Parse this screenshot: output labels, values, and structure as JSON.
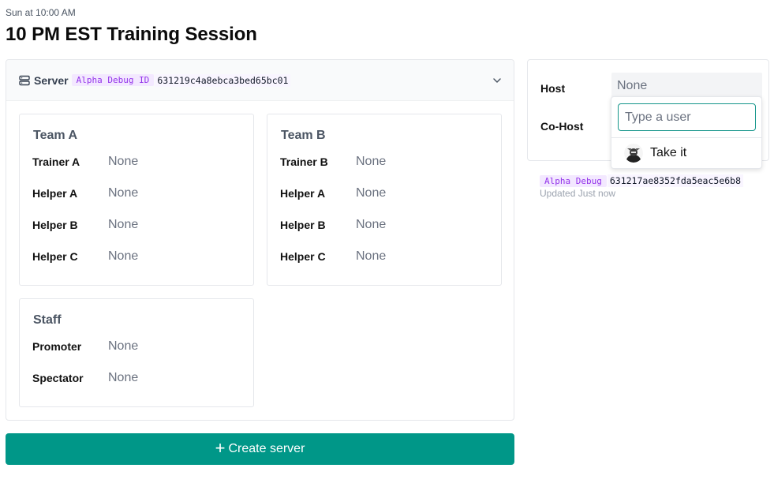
{
  "event": {
    "datetime": "Sun at 10:00 AM",
    "title": "10 PM EST Training Session"
  },
  "server": {
    "label": "Server",
    "debug_badge": "Alpha Debug ID",
    "debug_id": "631219c4a8ebca3bed65bc01",
    "icon": "server-icon",
    "collapse_icon": "chevron-down-icon"
  },
  "teams": {
    "team_a": {
      "title": "Team A",
      "rows": [
        {
          "label": "Trainer A",
          "value": "None"
        },
        {
          "label": "Helper A",
          "value": "None"
        },
        {
          "label": "Helper B",
          "value": "None"
        },
        {
          "label": "Helper C",
          "value": "None"
        }
      ]
    },
    "team_b": {
      "title": "Team B",
      "rows": [
        {
          "label": "Trainer B",
          "value": "None"
        },
        {
          "label": "Helper A",
          "value": "None"
        },
        {
          "label": "Helper B",
          "value": "None"
        },
        {
          "label": "Helper C",
          "value": "None"
        }
      ]
    },
    "staff": {
      "title": "Staff",
      "rows": [
        {
          "label": "Promoter",
          "value": "None"
        },
        {
          "label": "Spectator",
          "value": "None"
        }
      ]
    }
  },
  "create_button": {
    "label": "Create server",
    "icon": "plus-icon"
  },
  "host_panel": {
    "host_label": "Host",
    "host_value": "None",
    "cohost_label": "Co-Host",
    "dropdown": {
      "placeholder": "Type a user",
      "value": "",
      "option_label": "Take it",
      "option_icon": "user-avatar"
    },
    "debug_badge": "Alpha Debug",
    "debug_id": "631217ae8352fda5eac5e6b8",
    "updated": "Updated Just now"
  },
  "colors": {
    "accent": "#009788",
    "debug_bg": "#f3e8ff",
    "debug_text": "#9333ea"
  }
}
